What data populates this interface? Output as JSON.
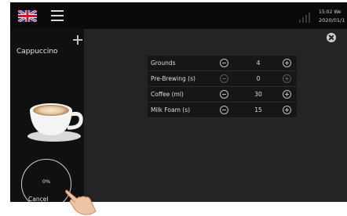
{
  "status_bar": {
    "time": "15:02 We",
    "date": "2020/01/1",
    "icons": [
      "uk-flag-icon",
      "menu-icon",
      "signal-icon"
    ]
  },
  "product": {
    "name": "Cappuccino",
    "icon": "cappuccino-cup-icon"
  },
  "progress": {
    "label": "0%",
    "value_percent": 0,
    "cancel_label": "Cancel"
  },
  "settings": [
    {
      "label": "Grounds",
      "value": "4",
      "enabled": true
    },
    {
      "label": "Pre-Brewing (s)",
      "value": "0",
      "enabled": false
    },
    {
      "label": "Coffee (ml)",
      "value": "30",
      "enabled": true
    },
    {
      "label": "Milk Foam (s)",
      "value": "15",
      "enabled": true
    }
  ],
  "colors": {
    "screen_background": "#0c0c0c",
    "panel_background": "#242424",
    "row_background": "#161616",
    "text": "#dddddd",
    "disabled_control": "#5a5a5a"
  }
}
